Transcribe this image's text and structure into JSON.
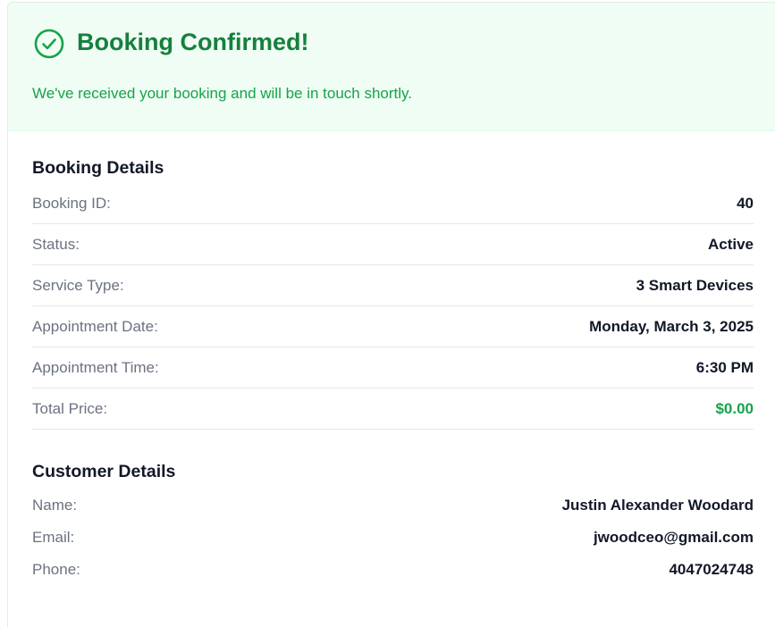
{
  "header": {
    "title": "Booking Confirmed!",
    "subtitle": "We've received your booking and will be in touch shortly."
  },
  "booking": {
    "section_title": "Booking Details",
    "rows": [
      {
        "label": "Booking ID:",
        "value": "40"
      },
      {
        "label": "Status:",
        "value": "Active"
      },
      {
        "label": "Service Type:",
        "value": "3 Smart Devices"
      },
      {
        "label": "Appointment Date:",
        "value": "Monday, March 3, 2025"
      },
      {
        "label": "Appointment Time:",
        "value": "6:30 PM"
      },
      {
        "label": "Total Price:",
        "value": "$0.00"
      }
    ]
  },
  "customer": {
    "section_title": "Customer Details",
    "rows": [
      {
        "label": "Name:",
        "value": "Justin Alexander Woodard"
      },
      {
        "label": "Email:",
        "value": "jwoodceo@gmail.com"
      },
      {
        "label": "Phone:",
        "value": "4047024748"
      }
    ]
  },
  "colors": {
    "success_text": "#15803d",
    "success_light": "#16a34a",
    "header_bg": "#f0fdf4"
  },
  "icons": {
    "header_icon": "check-circle-icon"
  }
}
